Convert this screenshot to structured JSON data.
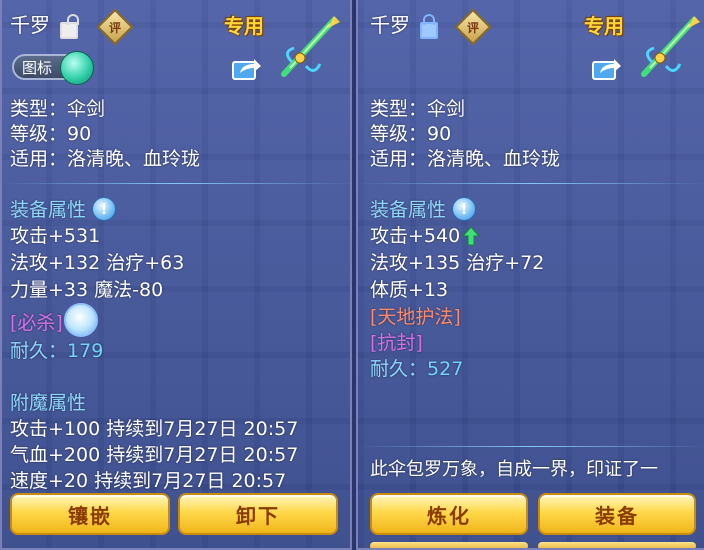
{
  "left_panel": {
    "name": "千罗",
    "lock": "unlock-icon",
    "rate_badge": "评",
    "exclusive": "专用",
    "icon_toggle_label": "图标",
    "type": "类型：伞剑",
    "level": "等级：90",
    "applies": "适用：洛清晚、血玲珑",
    "equip_title": "装备属性",
    "attrs": [
      "攻击+531",
      "法攻+132 治疗+63",
      "力量+33 魔法-80"
    ],
    "skill": "[必杀]",
    "durability_label": "耐久：",
    "durability_value": "179",
    "enchant_title": "附魔属性",
    "enchants": [
      "攻击+100 持续到7月27日 20:57",
      "气血+200 持续到7月27日 20:57",
      "速度+20 持续到7月27日 20:57"
    ],
    "buttons": [
      "镶嵌",
      "卸下"
    ]
  },
  "right_panel": {
    "name": "千罗",
    "lock": "lock-icon",
    "rate_badge": "评",
    "exclusive": "专用",
    "type": "类型：伞剑",
    "level": "等级：90",
    "applies": "适用：洛清晚、血玲珑",
    "equip_title": "装备属性",
    "attrs": [
      "攻击+540",
      "法攻+135 治疗+72",
      "体质+13"
    ],
    "special": "[天地护法]",
    "skill": "[抗封]",
    "durability_label": "耐久：",
    "durability_value": "527",
    "description": "此伞包罗万象，自成一界，印证了一",
    "buttons": [
      "炼化",
      "装备"
    ]
  },
  "colors": {
    "title": "#8ed8ff",
    "skill": "#d86ee8",
    "special": "#ff8a6a",
    "exclusive": "#ffd63a",
    "button": "#ffd94a"
  }
}
